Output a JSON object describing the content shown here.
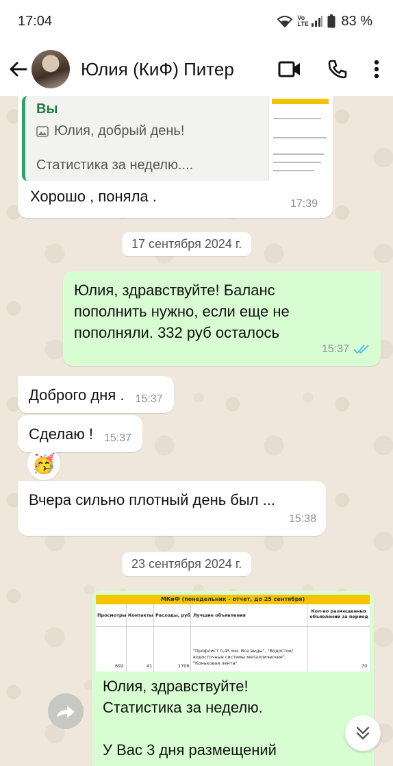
{
  "status_bar": {
    "time": "17:04",
    "battery": "83 %",
    "volte_label": "Vo LTE"
  },
  "header": {
    "contact_name": "Юлия (КиФ) Питер",
    "icons": [
      "back-arrow-icon",
      "avatar",
      "video-call-icon",
      "phone-icon",
      "more-icon"
    ]
  },
  "messages": [
    {
      "id": "reply",
      "direction": "in",
      "quote": {
        "author": "Вы",
        "line1": "Юлия, добрый день!",
        "line2": "Статистика за неделю...."
      },
      "text": "Хорошо , поняла .",
      "time": "17:39"
    },
    {
      "id": "date1",
      "type": "date",
      "text": "17 сентября 2024 г."
    },
    {
      "id": "balance",
      "direction": "out",
      "text": [
        "Юлия, здравствуйте! Баланс",
        "пополнить нужно, если еще не",
        "пополняли. 332 руб осталось"
      ],
      "time": "15:37",
      "status": "read"
    },
    {
      "id": "m1",
      "direction": "in",
      "text": "Доброго дня .",
      "time": "15:37"
    },
    {
      "id": "m2",
      "direction": "in",
      "text": "Сделаю !",
      "time": "15:37"
    },
    {
      "id": "reaction",
      "type": "reaction",
      "emoji": "🥳"
    },
    {
      "id": "m3",
      "direction": "in",
      "text": "Вчера сильно плотный день был ...",
      "time": "15:38"
    },
    {
      "id": "date2",
      "type": "date",
      "text": "23 сентября 2024 г."
    },
    {
      "id": "report",
      "direction": "out",
      "image": {
        "title": "МКиФ (понедельник - отчет, до 25 сентября)",
        "headers": [
          "Просмотры",
          "Контакты",
          "Расходы, руб",
          "Лучшие объявления",
          "Кол-во размещенных объявлений за период"
        ],
        "row": [
          "692",
          "41",
          "1706",
          "\"Профлист 0,45 мм. Все виды\", \"Водосток/водосточные системы металлические\", \"Коньковая лента\"",
          "70"
        ]
      },
      "caption": [
        "Юлия, здравствуйте!",
        "Статистика за неделю.",
        "",
        "У Вас 3 дня размещений"
      ]
    }
  ],
  "colors": {
    "outgoing_bubble": "#d9fdd3",
    "incoming_bubble": "#ffffff",
    "read_ticks": "#53bdeb",
    "quote_accent": "#25a863"
  }
}
